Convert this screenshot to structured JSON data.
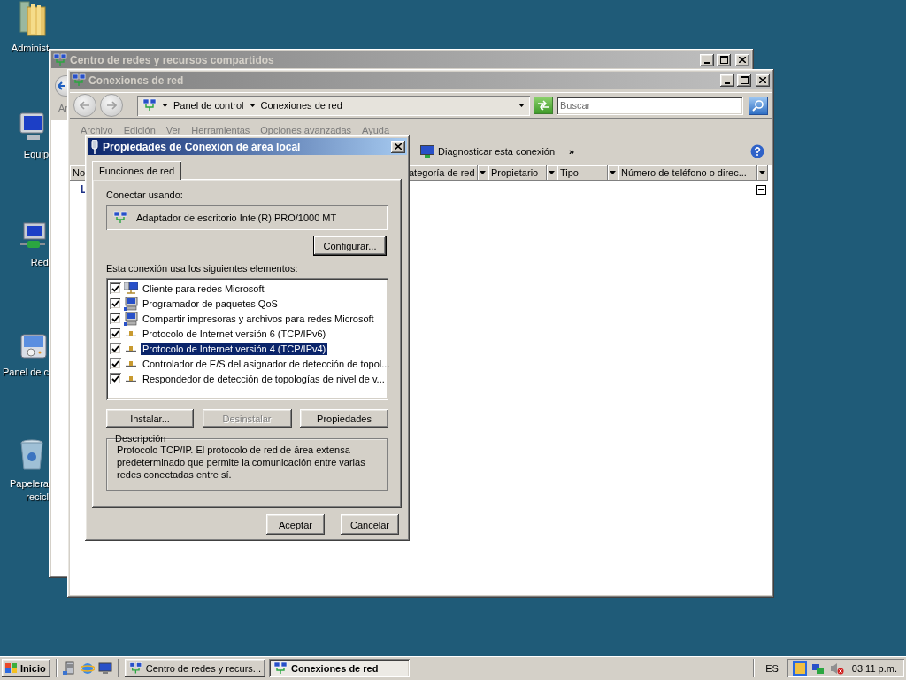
{
  "desktop_icons": [
    {
      "kind": "folder",
      "lines": [
        "Administ"
      ]
    },
    {
      "kind": "computer",
      "lines": [
        "Equip"
      ]
    },
    {
      "kind": "network",
      "lines": [
        "Red"
      ]
    },
    {
      "kind": "control-panel",
      "lines": [
        "Panel de c"
      ]
    },
    {
      "kind": "recycle-bin",
      "lines": [
        "Papelera",
        "recicl"
      ]
    }
  ],
  "back_window": {
    "title": "Centro de redes y recursos compartidos",
    "active": false,
    "menu": [
      "Ar"
    ]
  },
  "window": {
    "title": "Conexiones de red",
    "active": false,
    "breadcrumb": [
      "Panel de control",
      "Conexiones de red"
    ],
    "search": {
      "placeholder": "Buscar"
    },
    "menu": [
      "Archivo",
      "Edición",
      "Ver",
      "Herramientas",
      "Opciones avanzadas",
      "Ayuda"
    ],
    "toolbar": [
      "Diagnosticar esta conexión"
    ],
    "more": "»",
    "columns": [
      "No",
      "ategoría de red",
      "Propietario",
      "Tipo",
      "Número de teléfono o direc..."
    ],
    "rows": [
      {
        "label": "L"
      }
    ]
  },
  "dialog": {
    "title": "Propiedades de Conexión de área local",
    "active": true,
    "tabs": [
      {
        "label": "Funciones de red",
        "selected": true
      }
    ],
    "connect_label": "Conectar usando:",
    "adapter": "Adaptador de escritorio Intel(R) PRO/1000 MT",
    "configure_button": "Configurar...",
    "items_label": "Esta conexión usa los siguientes elementos:",
    "items": [
      {
        "kind": "client",
        "label": "Cliente para redes Microsoft",
        "checked": true,
        "selected": false
      },
      {
        "kind": "service",
        "label": "Programador de paquetes QoS",
        "checked": true,
        "selected": false
      },
      {
        "kind": "service",
        "label": "Compartir impresoras y archivos para redes Microsoft",
        "checked": true,
        "selected": false
      },
      {
        "kind": "protocol",
        "label": "Protocolo de Internet versión 6 (TCP/IPv6)",
        "checked": true,
        "selected": false
      },
      {
        "kind": "protocol",
        "label": "Protocolo de Internet versión 4 (TCP/IPv4)",
        "checked": true,
        "selected": true
      },
      {
        "kind": "protocol",
        "label": "Controlador de E/S del asignador de detección de topol...",
        "checked": true,
        "selected": false
      },
      {
        "kind": "protocol",
        "label": "Respondedor de detección de topologías de nivel de v...",
        "checked": true,
        "selected": false
      }
    ],
    "buttons": [
      {
        "label": "Instalar...",
        "disabled": false
      },
      {
        "label": "Desinstalar",
        "disabled": true
      },
      {
        "label": "Propiedades",
        "disabled": false
      }
    ],
    "description": {
      "title": "Descripción",
      "text": "Protocolo TCP/IP. El protocolo de red de área extensa predeterminado que permite la comunicación entre varias redes conectadas entre sí."
    },
    "footer_buttons": [
      "Aceptar",
      "Cancelar"
    ]
  },
  "taskbar": {
    "start": "Inicio",
    "tasks": [
      {
        "label": "Centro de redes y recurs...",
        "selected": false
      },
      {
        "label": "Conexiones de red",
        "selected": true
      }
    ],
    "language": "ES",
    "clock": "03:11 p.m."
  }
}
